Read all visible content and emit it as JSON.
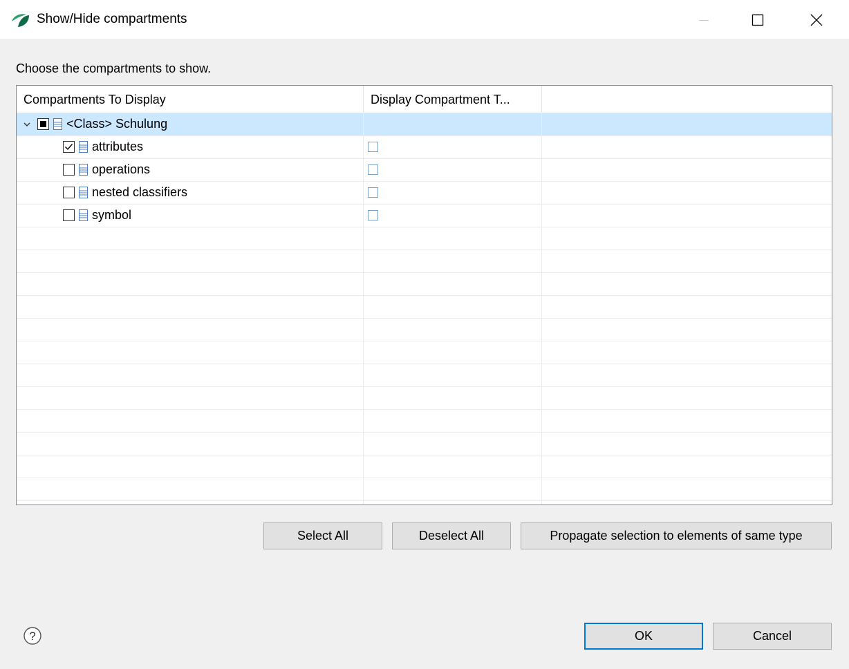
{
  "window": {
    "title": "Show/Hide compartments",
    "icon": "papyrus-leaf-icon",
    "controls": [
      "minimize-icon",
      "maximize-icon",
      "close-icon"
    ]
  },
  "instruction": "Choose the compartments to show.",
  "table": {
    "columns": [
      "Compartments To Display",
      "Display Compartment T...",
      ""
    ],
    "root": {
      "label": "<Class> Schulung",
      "expanded": true,
      "check_state": "partial",
      "selected": true
    },
    "children": [
      {
        "label": "attributes",
        "checked": true,
        "display_title": false
      },
      {
        "label": "operations",
        "checked": false,
        "display_title": false
      },
      {
        "label": "nested classifiers",
        "checked": false,
        "display_title": false
      },
      {
        "label": "symbol",
        "checked": false,
        "display_title": false
      }
    ]
  },
  "buttons": {
    "select_all": "Select All",
    "deselect_all": "Deselect All",
    "propagate": "Propagate selection to elements of same type",
    "ok": "OK",
    "cancel": "Cancel"
  },
  "colors": {
    "selection": "#cce8ff",
    "dialog_bg": "#f0f0f0",
    "accent": "#0078d7"
  }
}
